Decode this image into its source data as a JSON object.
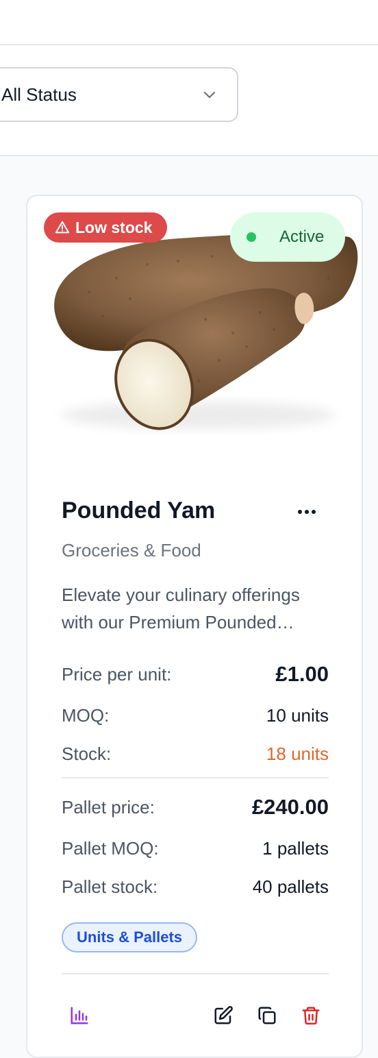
{
  "filters": {
    "status_select": {
      "value": "All Status",
      "icon": "chevron-down-icon"
    }
  },
  "product": {
    "badges": {
      "low_stock": "Low stock",
      "status": "Active"
    },
    "title": "Pounded Yam",
    "category": "Groceries & Food",
    "description_line1": "Elevate your culinary offerings",
    "description_line2": "with our Premium Pounded…",
    "unit": {
      "price_label": "Price per unit:",
      "price_value": "£1.00",
      "moq_label": "MOQ:",
      "moq_value": "10 units",
      "stock_label": "Stock:",
      "stock_value": "18 units"
    },
    "pallet": {
      "price_label": "Pallet price:",
      "price_value": "£240.00",
      "moq_label": "Pallet MOQ:",
      "moq_value": "1 pallets",
      "stock_label": "Pallet stock:",
      "stock_value": "40 pallets"
    },
    "sale_type_chip": "Units & Pallets",
    "actions": [
      "analytics-icon",
      "edit-icon",
      "duplicate-icon",
      "delete-icon"
    ]
  },
  "colors": {
    "low_stock_badge": "#dc4a4a",
    "active_badge_bg": "#dcfce7",
    "active_dot": "#22c55e",
    "stock_warning": "#e0662a",
    "chip_text": "#1d4ed8",
    "delete": "#dc2626",
    "analytics": "#9333ea"
  }
}
